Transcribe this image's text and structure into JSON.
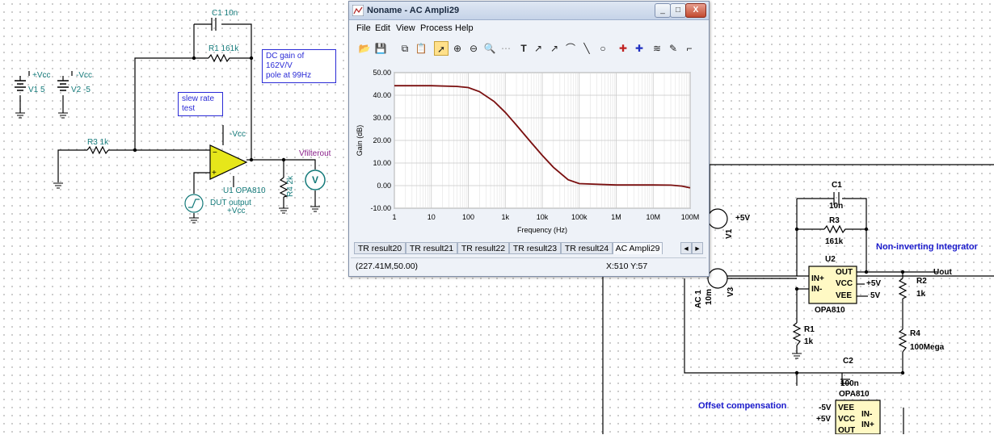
{
  "window": {
    "title": "Noname - AC Ampli29",
    "min_label": "_",
    "max_label": "□",
    "close_label": "X"
  },
  "menu": [
    "File",
    "Edit",
    "View",
    "Process",
    "Help"
  ],
  "tabs": [
    "TR result20",
    "TR result21",
    "TR result22",
    "TR result23",
    "TR result24",
    "AC Ampli29"
  ],
  "tab_scroll_left": "◂",
  "tab_scroll_right": "▸",
  "status": {
    "coords": "(227.41M,50.00)",
    "cursor": "X:510  Y:57"
  },
  "left_schematic": {
    "c1": "C1 10n",
    "r1": "R1 161k",
    "note_dc": "DC gain of 162V/V\npole at 99Hz",
    "note_slew": "slew rate\ntest",
    "vcc_pos": "+Vcc",
    "vcc_neg": "-Vcc",
    "v1": "V1 5",
    "v2": "V2 -5",
    "r3": "R3 1k",
    "neg_vcc_op": "-Vcc",
    "u1": "U1 OPA810",
    "dut": "DUT output",
    "pos_vcc_op": "+Vcc",
    "vfilter": "Vfilterout",
    "r4": "R4 2k",
    "meter": "V"
  },
  "right_schematic": {
    "title_integrator": "Non-inverting Integrator",
    "title_offset": "Offset compensation",
    "c1": "C1",
    "c1_val": "10n",
    "r3": "R3",
    "r3_val": "161k",
    "v1": "V1",
    "v1_val": "+5V",
    "u2": "U2",
    "u2_pins": [
      "IN+",
      "IN-",
      "OUT",
      "VCC",
      "VEE"
    ],
    "u2_vcc": "+5V",
    "u2_vee": "5V",
    "u2_name": "OPA810",
    "uout": "Uout",
    "r2": "R2",
    "r2_val": "1k",
    "r1": "R1",
    "r1_val": "1k",
    "ac1": "AC 1",
    "ac1_val": "10m",
    "v3": "V3",
    "r4": "R4",
    "r4_val": "100Mega",
    "c2": "C2",
    "c2_val": "100n",
    "u3_name": "OPA810",
    "u3_pins": [
      "VEE",
      "VCC",
      "OUT",
      "IN-",
      "IN+"
    ],
    "u3_neg": "-5V",
    "u3_pos": "+5V"
  },
  "chart_data": {
    "type": "line",
    "xlabel": "Frequency (Hz)",
    "ylabel": "Gain (dB)",
    "xscale": "log",
    "xlim": [
      1,
      100000000
    ],
    "ylim": [
      -10,
      50
    ],
    "x_ticks": [
      "1",
      "10",
      "100",
      "1k",
      "10k",
      "100k",
      "1M",
      "10M",
      "100M"
    ],
    "y_ticks": [
      "50.00",
      "40.00",
      "30.00",
      "20.00",
      "10.00",
      "0.00",
      "-10.00"
    ],
    "grid": true,
    "series": [
      {
        "color": "#7a0f0f",
        "x": [
          1,
          10,
          50,
          100,
          200,
          500,
          1000,
          2000,
          5000,
          10000,
          20000,
          50000,
          100000,
          1000000,
          10000000,
          30000000,
          60000000,
          100000000
        ],
        "y": [
          44.2,
          44.2,
          43.9,
          43.4,
          41.6,
          37.2,
          32.4,
          26.8,
          19.1,
          13.4,
          8.1,
          2.6,
          0.9,
          0.3,
          0.3,
          0.2,
          -0.2,
          -1.0
        ]
      }
    ]
  }
}
